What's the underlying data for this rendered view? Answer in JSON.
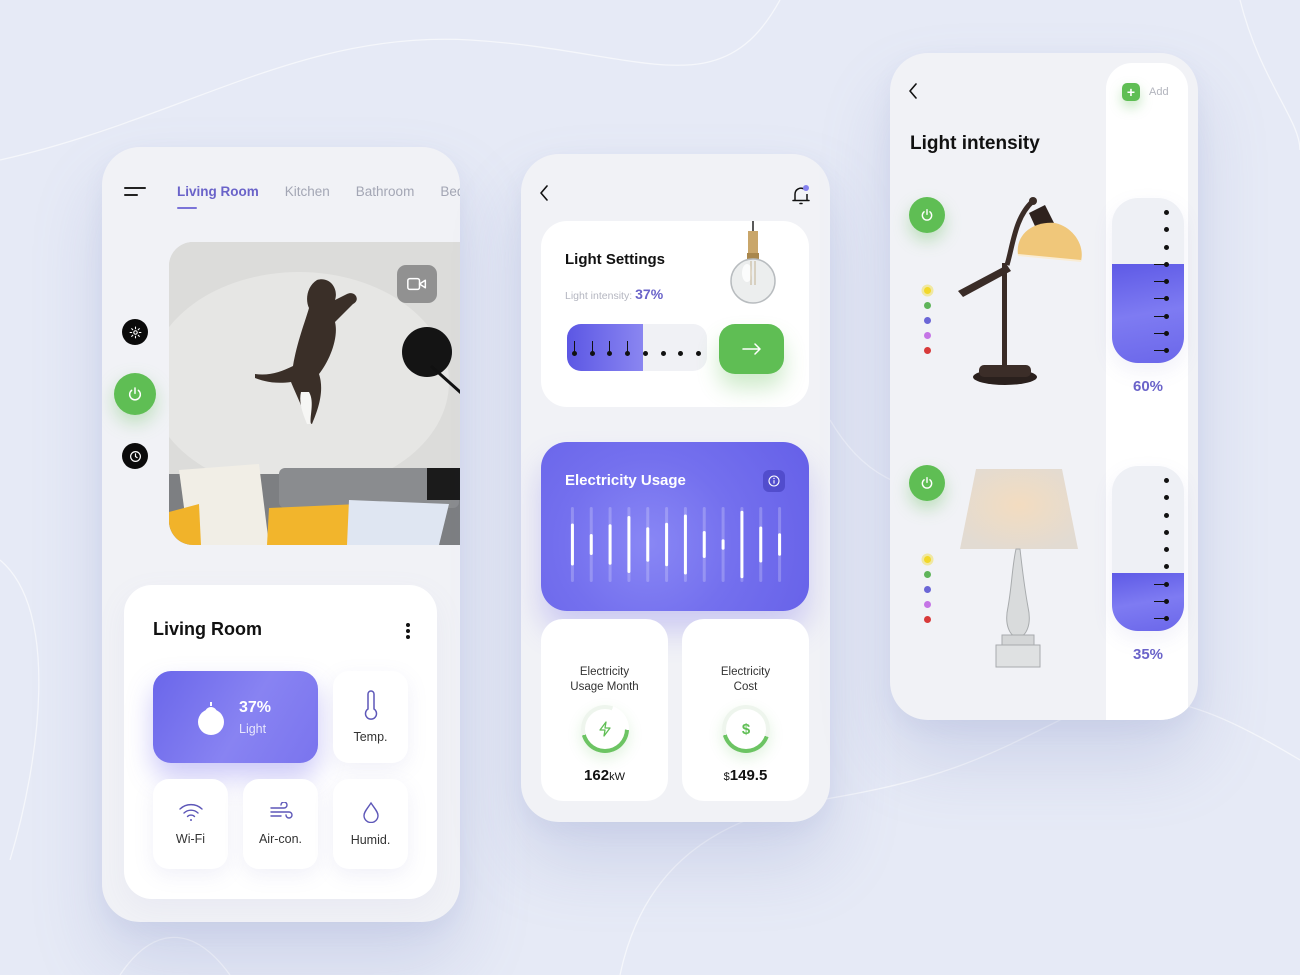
{
  "colors": {
    "background": "#e6eaf6",
    "accent_purple": "#6a63c9",
    "accent_indigo": "#6e6aec",
    "green": "#5fbe54"
  },
  "phone1": {
    "menu_icon": "hamburger-menu-icon",
    "tabs": [
      {
        "label": "Living Room",
        "active": true
      },
      {
        "label": "Kitchen",
        "active": false
      },
      {
        "label": "Bathroom",
        "active": false
      },
      {
        "label": "Bedroom",
        "active": false
      }
    ],
    "side_buttons": [
      {
        "icon": "gear-icon"
      },
      {
        "icon": "power-icon"
      },
      {
        "icon": "clock-icon"
      }
    ],
    "camera_feed": {
      "icon": "video-camera-icon",
      "alt": "Cat jumping in living room"
    },
    "room_card": {
      "title": "Living Room",
      "menu_icon": "kebab-menu-icon",
      "light": {
        "value": "37%",
        "label": "Light",
        "icon": "bulb-icon"
      },
      "devices": [
        {
          "label": "Temp.",
          "icon": "thermometer-icon"
        },
        {
          "label": "Wi-Fi",
          "icon": "wifi-icon"
        },
        {
          "label": "Air-con.",
          "icon": "wind-icon"
        },
        {
          "label": "Humid.",
          "icon": "droplet-icon"
        }
      ]
    }
  },
  "phone2": {
    "light_settings": {
      "title": "Light Settings",
      "intensity_label": "Light intensity:",
      "intensity_value": "37%",
      "slider_steps": 8,
      "slider_active_steps": 4,
      "slider_fill_fraction": 0.37,
      "go_icon": "arrow-right-icon"
    },
    "electricity_usage": {
      "title": "Electricity Usage",
      "info_icon": "info-icon",
      "bars": [
        0.56,
        0.28,
        0.54,
        0.76,
        0.46,
        0.58,
        0.8,
        0.36,
        0.14,
        0.9,
        0.48,
        0.3
      ]
    },
    "stats": [
      {
        "title_line1": "Electricity",
        "title_line2": "Usage Month",
        "icon": "lightning-icon",
        "value": "162",
        "unit": "kW",
        "prefix": ""
      },
      {
        "title_line1": "Electricity",
        "title_line2": "Cost",
        "icon": "dollar-icon",
        "value": "149.5",
        "unit": "",
        "prefix": "$"
      }
    ]
  },
  "phone3": {
    "title": "Light intensity",
    "add_label": "Add",
    "color_options": [
      "#f2d829",
      "#5fb45a",
      "#6b66d6",
      "#c575e6",
      "#d83a3a"
    ],
    "lamps": [
      {
        "name": "Desk lamp",
        "intensity": "60%",
        "intensity_fraction": 0.6,
        "ticks": 9,
        "ticks_on": 6,
        "selected_color": 0
      },
      {
        "name": "Table lamp",
        "intensity": "35%",
        "intensity_fraction": 0.35,
        "ticks": 9,
        "ticks_on": 3,
        "selected_color": 0
      }
    ]
  }
}
